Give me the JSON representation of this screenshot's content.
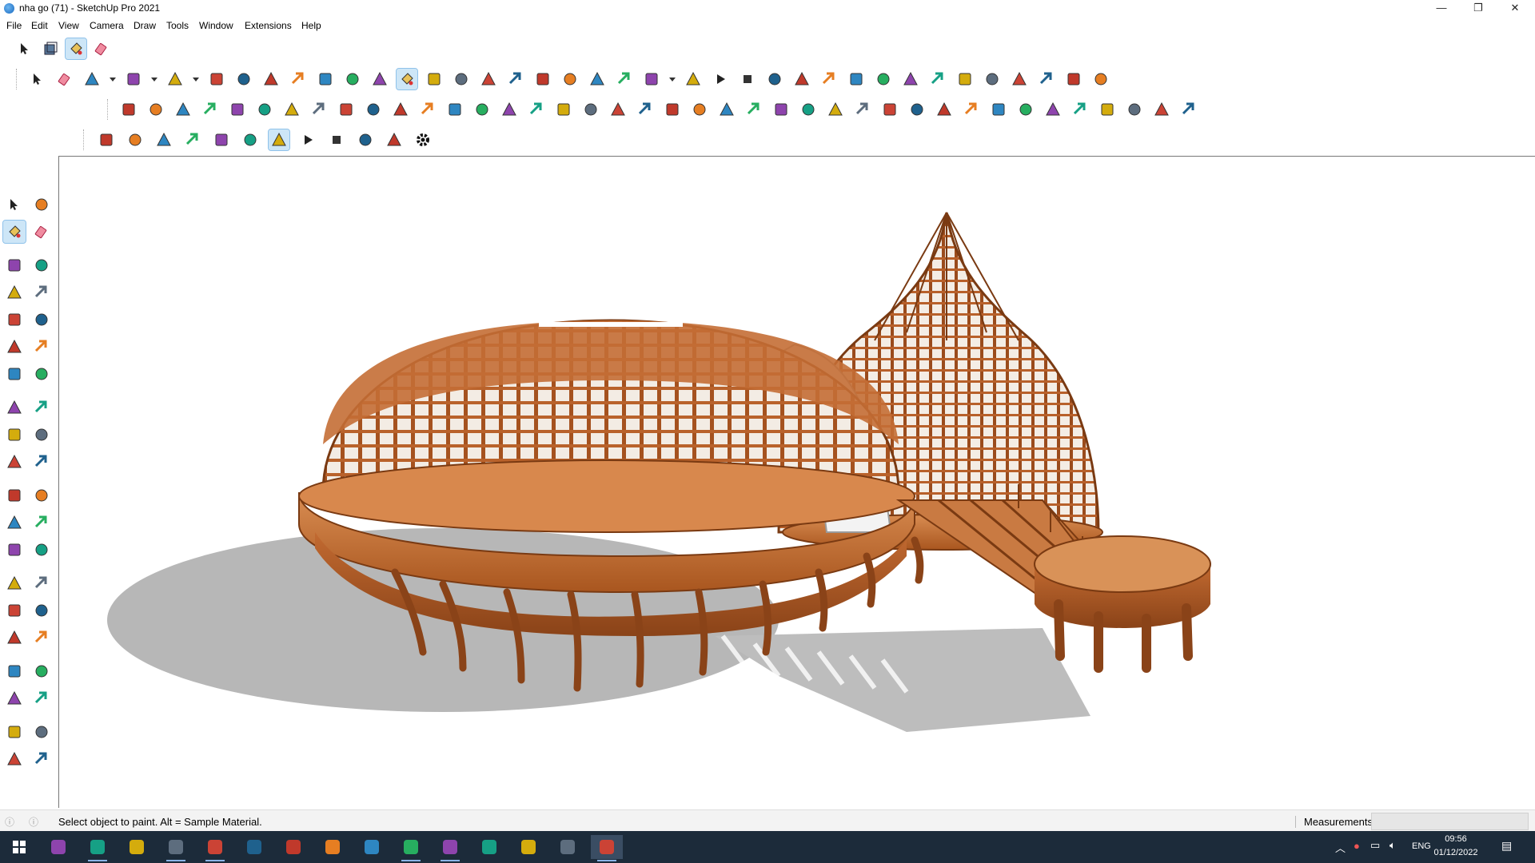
{
  "window": {
    "title": "nha go (71) - SketchUp Pro 2021",
    "controls": [
      "minimize-icon",
      "restore-icon",
      "close-icon"
    ]
  },
  "menu": [
    "File",
    "Edit",
    "View",
    "Camera",
    "Draw",
    "Tools",
    "Window",
    "Extensions",
    "Help"
  ],
  "toolbar_row1": [
    "select-icon",
    "component-icon",
    "paint-bucket-icon",
    "eraser-icon"
  ],
  "toolbar_row2": {
    "icons": [
      "select-icon",
      "eraser-icon",
      "line-icon",
      "dropdown-icon",
      "freehand-icon",
      "dropdown-icon",
      "rectangle-icon",
      "dropdown-icon",
      "push-pull-icon",
      "follow-me-icon",
      "move-icon",
      "rotate-icon",
      "scale-icon",
      "tape-measure-icon",
      "text-icon",
      "paint-bucket-icon",
      "orbit-icon",
      "pan-icon",
      "zoom-icon",
      "zoom-extents-icon",
      "outliner-icon",
      "tags-icon",
      "layers-icon",
      "scenes-icon",
      "account-icon",
      "dropdown-icon",
      "animation-icon",
      "play-icon",
      "stop-icon",
      "previous-icon",
      "sandbox-icon",
      "location-icon",
      "extension-icon",
      "section-icon",
      "x-ray-icon",
      "frost-icon",
      "wireframe-icon",
      "y-icon",
      "x-icon",
      "brush-icon",
      "cloth-icon",
      "person-icon"
    ]
  },
  "toolbar_row3": {
    "icons": [
      "bezier-icon",
      "pencil-icon",
      "house-icon",
      "circle-icon",
      "ellipse-icon",
      "oval-icon",
      "parallelogram-icon",
      "arc-icon",
      "polygon-icon",
      "spiral-icon",
      "shape-icon",
      "curve-icon",
      "fillet-icon",
      "clean-icon",
      "cube-icon",
      "gradient-icon",
      "column-icon",
      "arrows-up-icon",
      "arrows-down-icon",
      "connect-icon",
      "mirror-icon",
      "undo-icon",
      "redo-icon",
      "hand-icon",
      "dome-icon",
      "arrow-up-icon",
      "box-icon",
      "gem-icon",
      "cycle-icon",
      "surface-1-icon",
      "surface-2-icon",
      "surface-3-icon",
      "surface-4-icon",
      "surface-5-icon",
      "surface-6-icon",
      "surface-7-icon",
      "surface-8-icon",
      "surface-9-icon",
      "surface-10-icon",
      "stairs-icon"
    ]
  },
  "toolbar_row4": {
    "icons": [
      "tag-icon",
      "plane-icon",
      "star-icon",
      "fredo-icon",
      "bars-icon",
      "clock-icon",
      "vray-icon",
      "play-icon",
      "stop-icon",
      "frames-icon",
      "camera-icon",
      "settings-icon"
    ]
  },
  "left_toolbar": [
    "select-icon",
    "component-icon",
    "paint-bucket-icon",
    "eraser-icon",
    "line-icon",
    "freehand-icon",
    "rectangle-icon",
    "rotated-rectangle-icon",
    "circle-icon",
    "polygon-icon",
    "arc-icon",
    "2-point-arc-icon",
    "3-point-arc-icon",
    "pie-icon",
    "move-icon",
    "push-pull-icon",
    "rotate-icon",
    "follow-me-icon",
    "scale-icon",
    "offset-icon",
    "tape-measure-icon",
    "dimension-icon",
    "protractor-icon",
    "text-icon",
    "axes-icon",
    "3d-text-icon",
    "orbit-icon",
    "pan-icon",
    "zoom-icon",
    "zoom-window-icon",
    "zoom-extents-icon",
    "previous-view-icon",
    "position-camera-icon",
    "look-around-icon",
    "walk-icon",
    "section-plane-icon",
    "outliner-icon",
    "tags-icon",
    "layers-icon",
    "scenes-icon"
  ],
  "status": {
    "message": "Select object to paint. Alt = Sample Material.",
    "measurements_label": "Measurements",
    "measurements_value": ""
  },
  "taskbar": {
    "apps": [
      "windows-start-icon",
      "edge-icon",
      "file-explorer-icon",
      "app-3-icon",
      "chrome-icon",
      "excel-icon",
      "app-blue-icon",
      "shield-icon",
      "notepad-icon",
      "browser-icon",
      "sketchup-icon",
      "photoshop-icon",
      "calculator-icon",
      "curve-app-icon",
      "settings-icon",
      "sketchup-active-icon"
    ],
    "language": "ENG",
    "time": "09:56",
    "date": "01/12/2022"
  },
  "colors": {
    "wood": "#b8622b",
    "wood_light": "#d9884a",
    "shadow": "#b9b9b9",
    "selection": "#cde6f7"
  }
}
